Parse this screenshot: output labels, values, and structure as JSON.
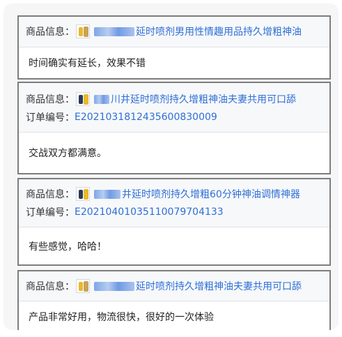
{
  "labels": {
    "product": "商品信息：",
    "order": "订单编号："
  },
  "thumb_colors": {
    "yellow": "#e8b92a",
    "dark": "#2a3b55",
    "gold": "#c9a25a"
  },
  "reviews": [
    {
      "product": "延时喷剂男用性情趣用品持久增粗神油",
      "order_no": "",
      "comment": "时间确实有延长，效果不错"
    },
    {
      "product": "川井延时喷剂持久增粗神油夫妻共用可口舔",
      "order_no": "E2021031812435600830009",
      "comment": "交战双方都满意。"
    },
    {
      "product": "井延时喷剂持久增粗60分钟神油调情神器",
      "order_no": "E20210401035110079704133",
      "comment": "有些感觉，哈哈！"
    },
    {
      "product": "延时喷剂持久增粗神油夫妻共用可口舔",
      "order_no": "",
      "comment": "产品非常好用，物流很快，很好的一次体验"
    }
  ]
}
